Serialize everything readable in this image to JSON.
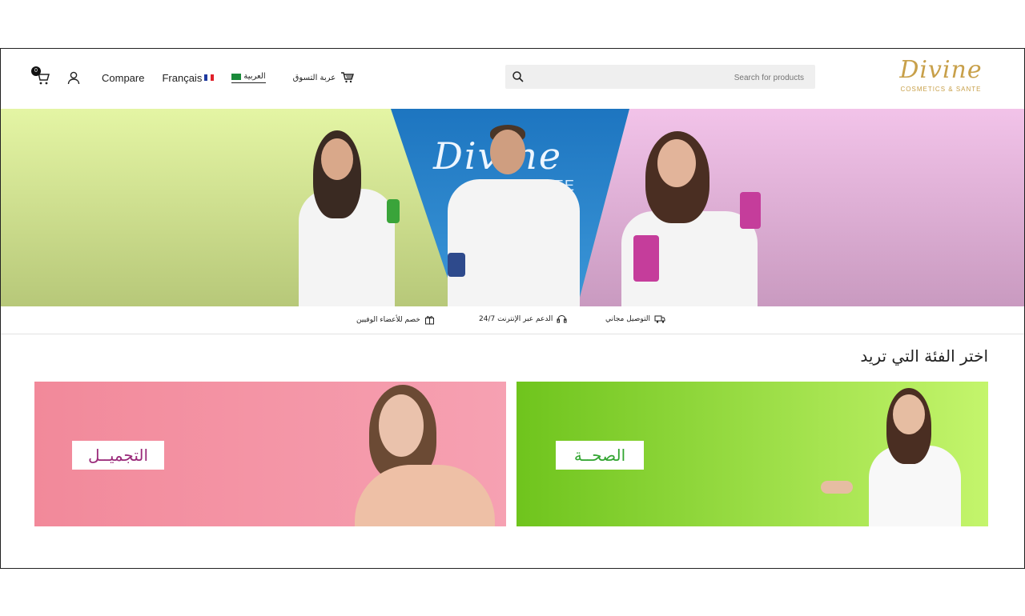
{
  "header": {
    "logo_text": "Divine",
    "logo_subtitle": "COSMETICS & SANTE",
    "search_placeholder": "Search for products",
    "cart_count": "0",
    "compare_label": "Compare",
    "lang_fr_label": "Français",
    "lang_ar_label": "العربية",
    "cart_label": "عربة التسوق"
  },
  "hero": {
    "brand_text": "Divine",
    "brand_sub": "NTE"
  },
  "features": [
    {
      "label": "التوصيل مجاني",
      "icon": "truck-icon"
    },
    {
      "label": "الدعم عبر الإنترنت 24/7",
      "icon": "headset-icon"
    },
    {
      "label": "خصم للأعضاء الوفيين",
      "icon": "gift-icon"
    }
  ],
  "categories": {
    "title": "اختر الفئة التي تريد",
    "items": [
      {
        "label": "الصحــة",
        "color": "#33a532"
      },
      {
        "label": "التجميــل",
        "color": "#9a2a7a"
      }
    ]
  },
  "colors": {
    "brand_gold": "#c8a04a",
    "hero_blue": "#1d75c0",
    "beauty_pink": "#f2899a",
    "health_green": "#6fc41d"
  }
}
